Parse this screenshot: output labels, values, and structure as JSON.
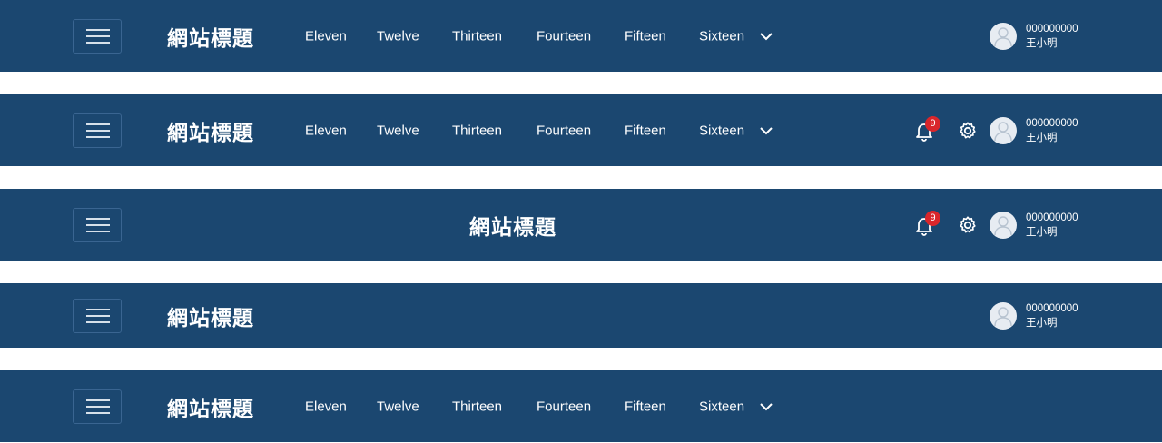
{
  "site_title": "網站標題",
  "nav_items": [
    "Eleven",
    "Twelve",
    "Thirteen",
    "Fourteen",
    "Fifteen",
    "Sixteen"
  ],
  "user": {
    "id": "000000000",
    "name": "王小明"
  },
  "notifications": {
    "count": "9"
  },
  "colors": {
    "bar": "#1b4770",
    "badge": "#d9262b",
    "text": "#ffffff"
  },
  "icons": {
    "menu": "hamburger-menu-icon",
    "more": "chevron-down-icon",
    "notifications": "bell-icon",
    "settings": "gear-icon",
    "avatar": "user-avatar-icon"
  }
}
